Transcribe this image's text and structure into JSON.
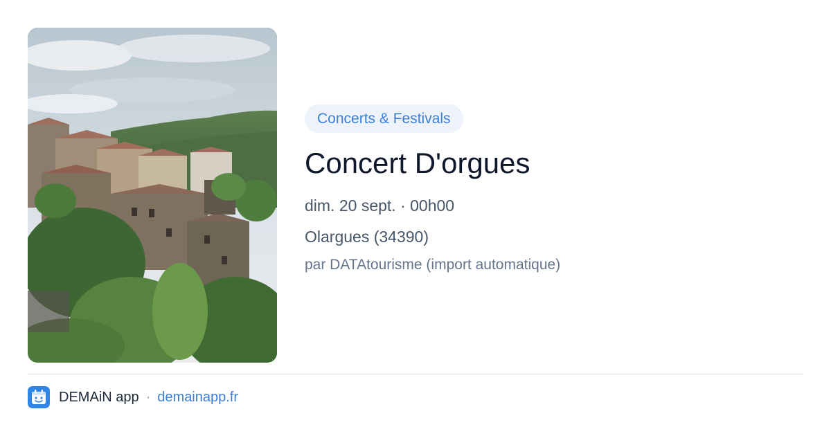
{
  "event": {
    "category": "Concerts & Festivals",
    "title": "Concert D'orgues",
    "datetime": "dim. 20 sept. · 00h00",
    "location": "Olargues (34390)",
    "source": "par DATAtourisme (import automatique)"
  },
  "footer": {
    "app_name": "DEMAiN app",
    "separator": "·",
    "link": "demainapp.fr"
  },
  "icons": {
    "app_logo": "demain-app-logo-icon"
  },
  "colors": {
    "accent": "#3a7fd5",
    "pill_background": "#eef3fa",
    "title": "#0f172a",
    "muted": "#64748b"
  }
}
